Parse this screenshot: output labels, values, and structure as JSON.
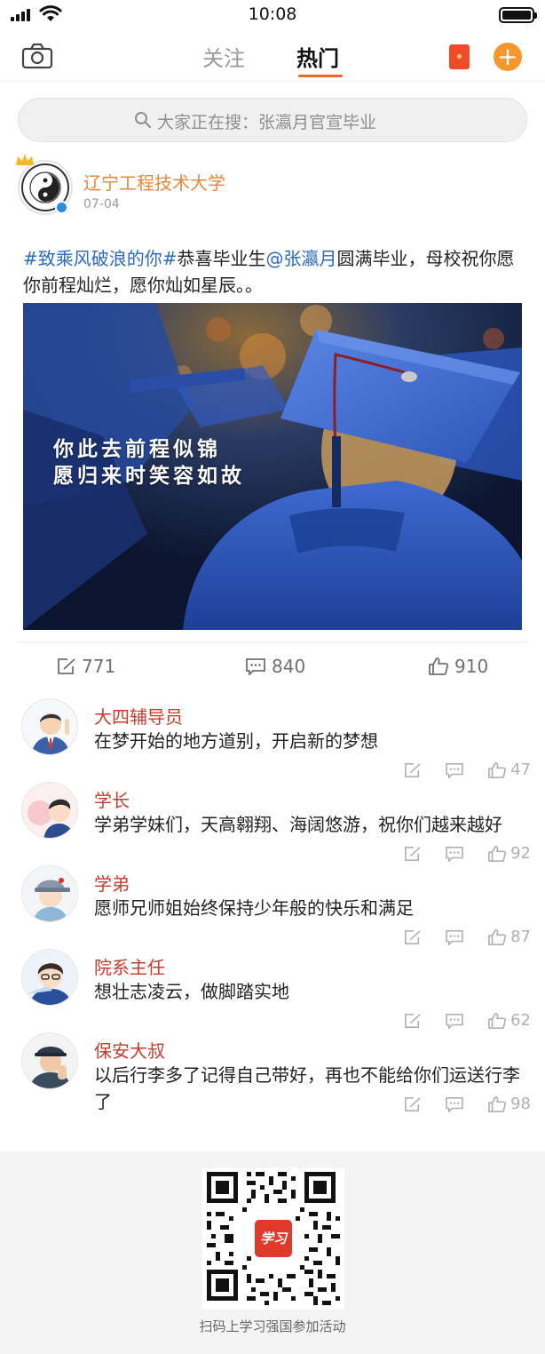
{
  "status_bar": {
    "time": "10:08"
  },
  "nav": {
    "tabs": [
      {
        "label": "关注"
      },
      {
        "label": "热门"
      }
    ]
  },
  "search": {
    "placeholder": "大家正在搜：张瀛月官宣毕业"
  },
  "post": {
    "author": "辽宁工程技术大学",
    "date": "07-04",
    "hashtag": "#致乘风破浪的你#",
    "text_1": "恭喜毕业生",
    "mention": "@张瀛月",
    "text_2": "圆满毕业，母校祝你愿你前程灿烂，愿你灿如星辰。。",
    "image_caption_line1": "你此去前程似锦",
    "image_caption_line2": "愿归来时笑容如故",
    "reposts": "771",
    "comments": "840",
    "likes": "910"
  },
  "comments": [
    {
      "name": "大四辅导员",
      "text": "在梦开始的地方道别，开启新的梦想",
      "likes": "47"
    },
    {
      "name": "学长",
      "text": "学弟学妹们，天高翱翔、海阔悠游，祝你们越来越好",
      "likes": "92"
    },
    {
      "name": "学弟",
      "text": "愿师兄师姐始终保持少年般的快乐和满足",
      "likes": "87"
    },
    {
      "name": "院系主任",
      "text": "想壮志凌云，做脚踏实地",
      "likes": "62"
    },
    {
      "name": "保安大叔",
      "text": "以后行李多了记得自己带好，再也不能给你们运送行李了",
      "likes": "98"
    }
  ],
  "footer": {
    "qr_logo_text": "学习",
    "text": "扫码上学习强国参加活动"
  },
  "colors": {
    "accent_orange": "#e8672c",
    "author_orange": "#e4883c",
    "link_blue": "#2b6bbd",
    "commenter_red": "#c73c2d"
  }
}
